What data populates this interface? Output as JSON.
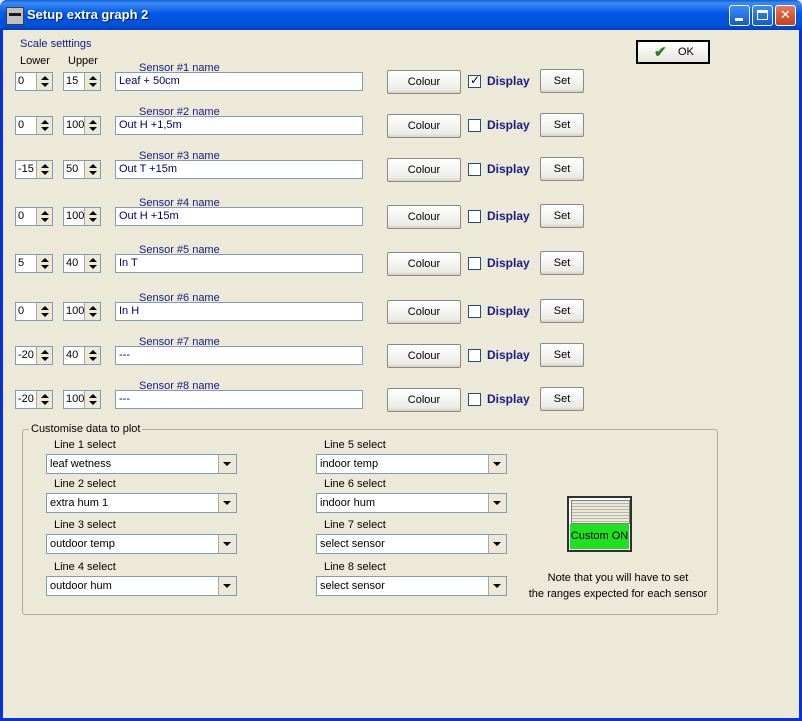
{
  "window": {
    "title": "Setup extra graph 2"
  },
  "scale_header": {
    "title": "Scale setttings",
    "lower": "Lower",
    "upper": "Upper"
  },
  "ok_label": "OK",
  "colour_label": "Colour",
  "display_label": "Display",
  "set_label": "Set",
  "sensors": [
    {
      "label": "Sensor #1 name",
      "lower": "0",
      "upper": "15",
      "name": "Leaf + 50cm",
      "display": true
    },
    {
      "label": "Sensor #2 name",
      "lower": "0",
      "upper": "100",
      "name": "Out H +1,5m",
      "display": false
    },
    {
      "label": "Sensor #3 name",
      "lower": "-15",
      "upper": "50",
      "name": "Out T +15m",
      "display": false
    },
    {
      "label": "Sensor #4 name",
      "lower": "0",
      "upper": "100",
      "name": "Out H +15m",
      "display": false
    },
    {
      "label": "Sensor #5 name",
      "lower": "5",
      "upper": "40",
      "name": "In T",
      "display": false
    },
    {
      "label": "Sensor #6 name",
      "lower": "0",
      "upper": "100",
      "name": "In H",
      "display": false
    },
    {
      "label": "Sensor #7 name",
      "lower": "-20",
      "upper": "40",
      "name": "---",
      "display": false
    },
    {
      "label": "Sensor #8 name",
      "lower": "-20",
      "upper": "100",
      "name": "---",
      "display": false
    }
  ],
  "customise": {
    "title": "Customise data to plot",
    "lines": [
      {
        "label": "Line 1 select",
        "value": "leaf wetness"
      },
      {
        "label": "Line 2 select",
        "value": "extra hum 1"
      },
      {
        "label": "Line 3 select",
        "value": "outdoor temp"
      },
      {
        "label": "Line 4 select",
        "value": "outdoor hum"
      },
      {
        "label": "Line 5 select",
        "value": "indoor temp"
      },
      {
        "label": "Line 6 select",
        "value": "indoor hum"
      },
      {
        "label": "Line 7 select",
        "value": "select sensor"
      },
      {
        "label": "Line 8 select",
        "value": "select sensor"
      }
    ],
    "custom_toggle": "Custom ON",
    "note_line1": "Note that you will have to set",
    "note_line2": "the ranges expected for each sensor"
  },
  "colors": {
    "title_bar": "#0058e6",
    "custom_on": "#21e021",
    "label_blue": "#1a1a8a"
  }
}
